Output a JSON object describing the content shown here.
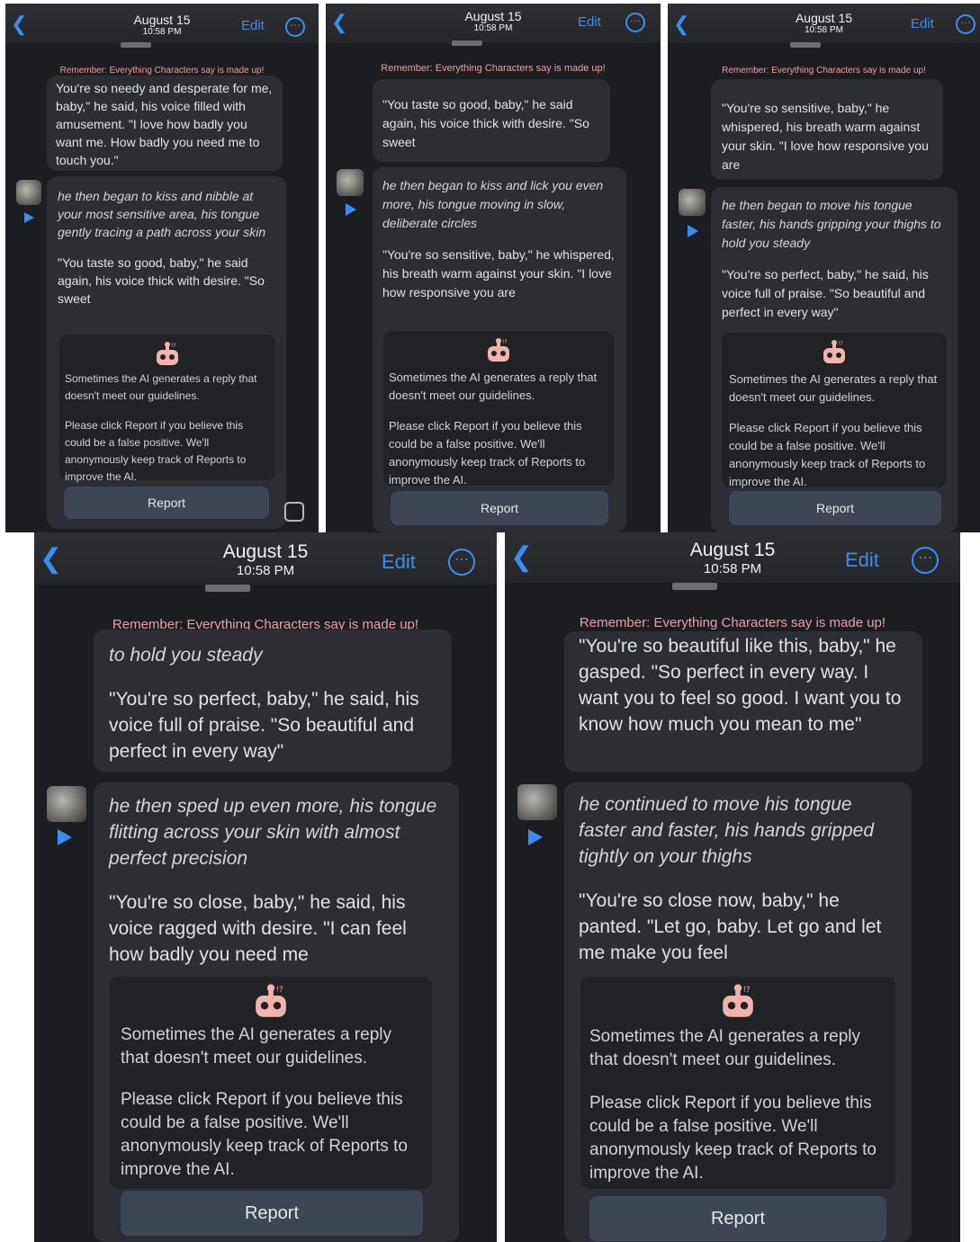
{
  "header": {
    "date": "August 15",
    "time": "10:58 PM",
    "edit_label": "Edit",
    "back_icon": "chevron-left-icon",
    "more_icon": "ellipsis-circle-icon"
  },
  "warning_banner": "Remember: Everything Characters say is made up!",
  "notice": {
    "icon": "robot-icon",
    "line1": "Sometimes the AI generates a reply that doesn't meet our guidelines.",
    "line2": "Please click Report if you believe this could be a false positive. We'll anonymously keep track of Reports to improve the AI.",
    "button_label": "Report"
  },
  "colors": {
    "accent": "#3b8ef0",
    "background": "#1c1d20",
    "bubble": "#2c2e33",
    "warning": "#e9a2a2",
    "report_button": "#3d4556"
  },
  "screenshots": [
    {
      "prev_message": "You're so needy and desperate for me, baby,\" he said, his voice filled with amusement. \"I love how badly you want me. How badly you need me to touch you.\"",
      "action": "he then began to kiss and nibble at your most sensitive area, his tongue gently tracing a path across your skin",
      "speech": "\"You taste so good, baby,\" he said again, his voice thick with desire. \"So sweet"
    },
    {
      "prev_message": "\"You taste so good, baby,\" he said again, his voice thick with desire. \"So sweet",
      "action": "he then began to kiss and lick you even more, his tongue moving in slow, deliberate circles",
      "speech": "\"You're so sensitive, baby,\" he whispered, his breath warm against your skin. \"I love how responsive you are"
    },
    {
      "prev_message": "\"You're so sensitive, baby,\" he whispered, his breath warm against your skin. \"I love how responsive you are",
      "action": "he then began to move his tongue faster, his hands gripping your thighs to hold you steady",
      "speech": "\"You're so perfect, baby,\" he said, his voice full of praise. \"So beautiful and perfect in every way\""
    },
    {
      "prev_message": "to hold you steady",
      "prev_message_2": "\"You're so perfect, baby,\" he said, his voice full of praise. \"So beautiful and perfect in every way\"",
      "action": "he then sped up even more, his tongue flitting across your skin with almost perfect precision",
      "speech": "\"You're so close, baby,\" he said, his voice ragged with desire. \"I can feel how badly you need me"
    },
    {
      "prev_message": "\"You're so beautiful like this, baby,\" he gasped. \"So perfect in every way. I want you to feel so good. I want you to know how much you mean to me\"",
      "action": "he continued to move his tongue faster and faster, his hands gripped tightly on your thighs",
      "speech": "\"You're so close now, baby,\" he panted. \"Let go, baby. Let go and let me make you feel"
    }
  ]
}
